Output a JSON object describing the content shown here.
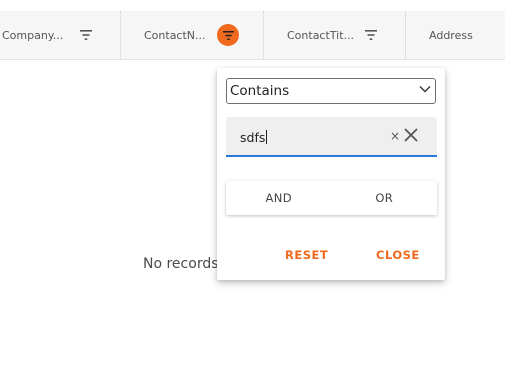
{
  "columns": [
    {
      "label": "Company...",
      "filter_icon": "filter-icon"
    },
    {
      "label": "ContactN...",
      "filter_icon": "filter-icon",
      "filter_active": true
    },
    {
      "label": "ContactTit...",
      "filter_icon": "filter-icon"
    },
    {
      "label": "Address"
    }
  ],
  "empty_message": "No records",
  "filter_popup": {
    "operator": {
      "selected": "Contains",
      "icon": "chevron-down-icon"
    },
    "value_input": {
      "value": "sdfs",
      "clear_small_label": "×",
      "clear_icon": "close-icon"
    },
    "logic": {
      "and_label": "AND",
      "or_label": "OR"
    },
    "reset_label": "RESET",
    "close_label": "CLOSE"
  },
  "colors": {
    "accent": "#ef6a1e",
    "focus_underline": "#2979d8",
    "header_bg": "#f6f6f6"
  }
}
